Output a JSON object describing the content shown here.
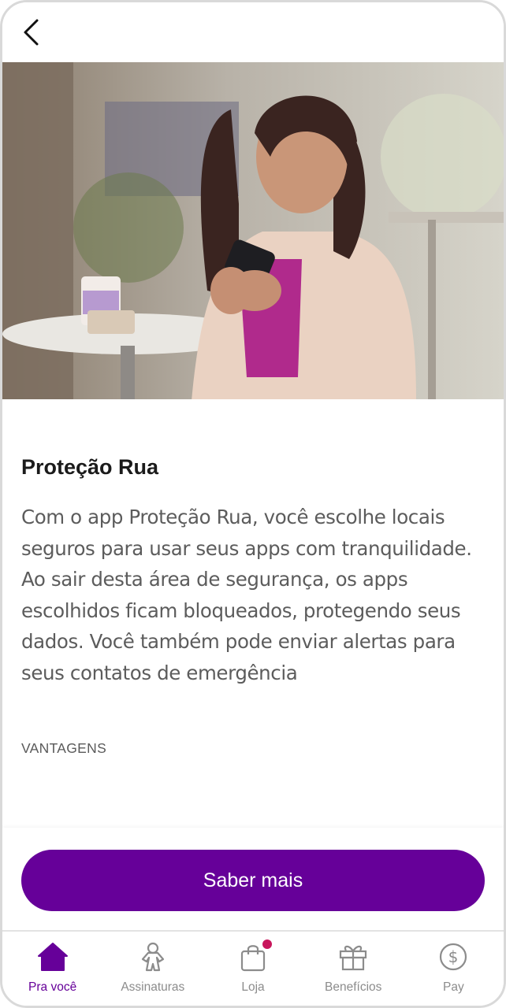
{
  "header": {
    "back_icon": "chevron-left-icon"
  },
  "hero": {
    "image": "woman-using-phone-in-cafe-photo"
  },
  "product": {
    "title": "Proteção Rua",
    "description": "Com o app Proteção Rua, você escolhe locais seguros para usar seus apps com tranquilidade. Ao sair desta área de segurança, os apps escolhidos ficam bloqueados, protegendo seus dados. Você também pode enviar alertas para seus contatos de emergência",
    "section_label": "VANTAGENS"
  },
  "cta": {
    "label": "Saber mais"
  },
  "nav": {
    "items": [
      {
        "label": "Pra você",
        "icon": "home-icon",
        "active": true
      },
      {
        "label": "Assinaturas",
        "icon": "person-icon",
        "active": false
      },
      {
        "label": "Loja",
        "icon": "shopping-bag-icon",
        "active": false,
        "badge": true
      },
      {
        "label": "Benefícios",
        "icon": "gift-icon",
        "active": false
      },
      {
        "label": "Pay",
        "icon": "dollar-icon",
        "active": false
      }
    ]
  },
  "colors": {
    "brand_purple": "#660099",
    "badge": "#c8165c",
    "nav_inactive": "#8c8c8c"
  }
}
